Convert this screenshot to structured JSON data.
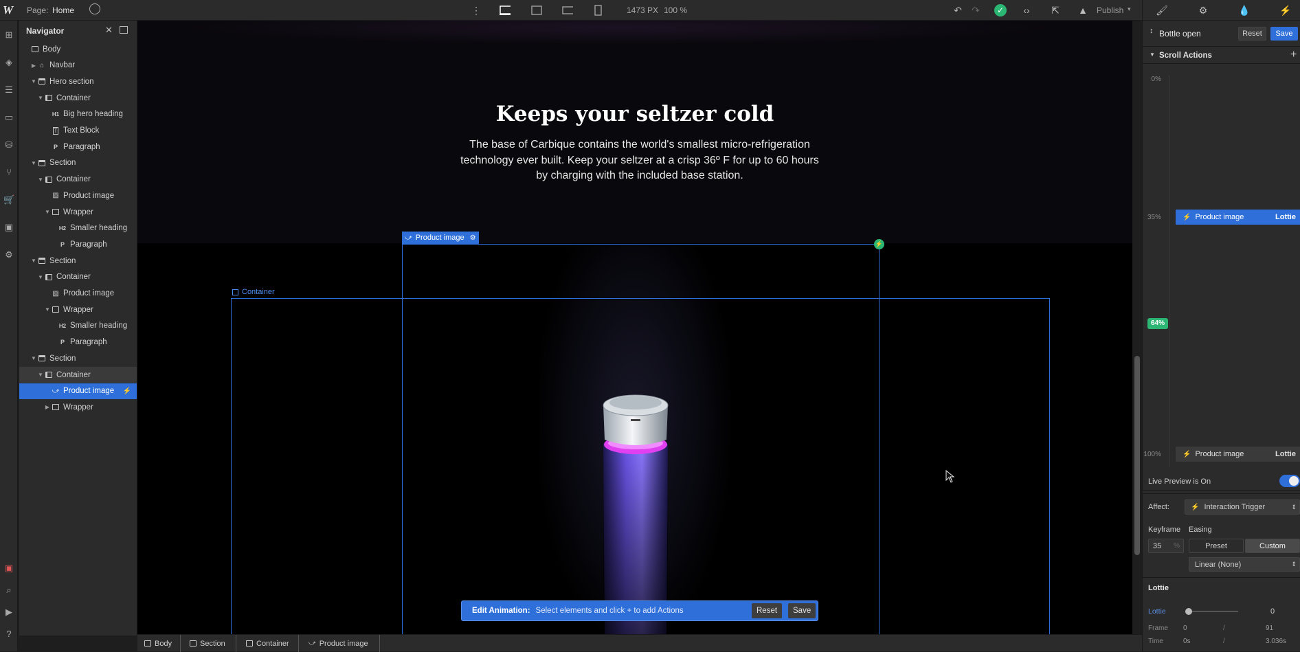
{
  "topbar": {
    "page_label": "Page:",
    "page_name": "Home",
    "size_px": "1473 PX",
    "zoom": "100 %",
    "publish_label": "Publish"
  },
  "navigator": {
    "title": "Navigator",
    "items": [
      {
        "label": "Body",
        "depth": 0,
        "icon": "box-icon",
        "caret": ""
      },
      {
        "label": "Navbar",
        "depth": 1,
        "icon": "home-icon",
        "caret": "collapsed"
      },
      {
        "label": "Hero section",
        "depth": 1,
        "icon": "section-icon",
        "caret": "expanded"
      },
      {
        "label": "Container",
        "depth": 2,
        "icon": "container-icon",
        "caret": "expanded"
      },
      {
        "label": "Big hero heading",
        "depth": 3,
        "icon": "h1-icon",
        "caret": ""
      },
      {
        "label": "Text Block",
        "depth": 3,
        "icon": "textblock-icon",
        "caret": ""
      },
      {
        "label": "Paragraph",
        "depth": 3,
        "icon": "paragraph-icon",
        "caret": ""
      },
      {
        "label": "Section",
        "depth": 1,
        "icon": "section-icon",
        "caret": "expanded"
      },
      {
        "label": "Container",
        "depth": 2,
        "icon": "container-icon",
        "caret": "expanded"
      },
      {
        "label": "Product image",
        "depth": 3,
        "icon": "image-icon",
        "caret": ""
      },
      {
        "label": "Wrapper",
        "depth": 3,
        "icon": "box-icon",
        "caret": "expanded"
      },
      {
        "label": "Smaller heading",
        "depth": 4,
        "icon": "h2-icon",
        "caret": ""
      },
      {
        "label": "Paragraph",
        "depth": 4,
        "icon": "paragraph-icon",
        "caret": ""
      },
      {
        "label": "Section",
        "depth": 1,
        "icon": "section-icon",
        "caret": "expanded"
      },
      {
        "label": "Container",
        "depth": 2,
        "icon": "container-icon",
        "caret": "expanded"
      },
      {
        "label": "Product image",
        "depth": 3,
        "icon": "image-icon",
        "caret": ""
      },
      {
        "label": "Wrapper",
        "depth": 3,
        "icon": "box-icon",
        "caret": "expanded"
      },
      {
        "label": "Smaller heading",
        "depth": 4,
        "icon": "h2-icon",
        "caret": ""
      },
      {
        "label": "Paragraph",
        "depth": 4,
        "icon": "paragraph-icon",
        "caret": ""
      },
      {
        "label": "Section",
        "depth": 1,
        "icon": "section-icon",
        "caret": "expanded"
      },
      {
        "label": "Container",
        "depth": 2,
        "icon": "container-icon",
        "caret": "expanded"
      },
      {
        "label": "Product image",
        "depth": 3,
        "icon": "lottie-icon",
        "caret": ""
      },
      {
        "label": "Wrapper",
        "depth": 3,
        "icon": "box-icon",
        "caret": "collapsed"
      }
    ],
    "selected_index": 21,
    "parent_index": 20
  },
  "canvas": {
    "heading": "Keeps your seltzer cold",
    "body_text": "The base of Carbique contains the world's smallest micro-refrigeration technology ever built. Keep your seltzer at a crisp 36º F for up to 60 hours by charging with the included base station.",
    "product_tag": "Product image",
    "container_tag": "Container"
  },
  "edit_animation": {
    "label": "Edit Animation:",
    "hint": "Select elements and click + to add Actions",
    "reset": "Reset",
    "save": "Save"
  },
  "breadcrumb": [
    "Body",
    "Section",
    "Container",
    "Product image"
  ],
  "right_panel": {
    "title": "Bottle open",
    "reset": "Reset",
    "save": "Save",
    "scroll_actions": "Scroll Actions",
    "timeline": {
      "p0": "0%",
      "p35": "35%",
      "p64": "64%",
      "p100": "100%",
      "kf1_target": "Product image",
      "kf1_type": "Lottie",
      "kf2_target": "Product image",
      "kf2_type": "Lottie"
    },
    "live_preview": "Live Preview is On",
    "affect_label": "Affect:",
    "affect_value": "Interaction Trigger",
    "keyframe_label": "Keyframe",
    "easing_label": "Easing",
    "keyframe_value": "35",
    "preset": "Preset",
    "custom": "Custom",
    "easing_value": "Linear (None)",
    "lottie_title": "Lottie",
    "lottie_label": "Lottie",
    "lottie_value": "0",
    "frame_label": "Frame",
    "frame_value": "0",
    "frame_max": "91",
    "time_label": "Time",
    "time_value": "0s",
    "time_max": "3.036s"
  },
  "colors": {
    "accent": "#2f6fd9",
    "green": "#2bb673"
  }
}
